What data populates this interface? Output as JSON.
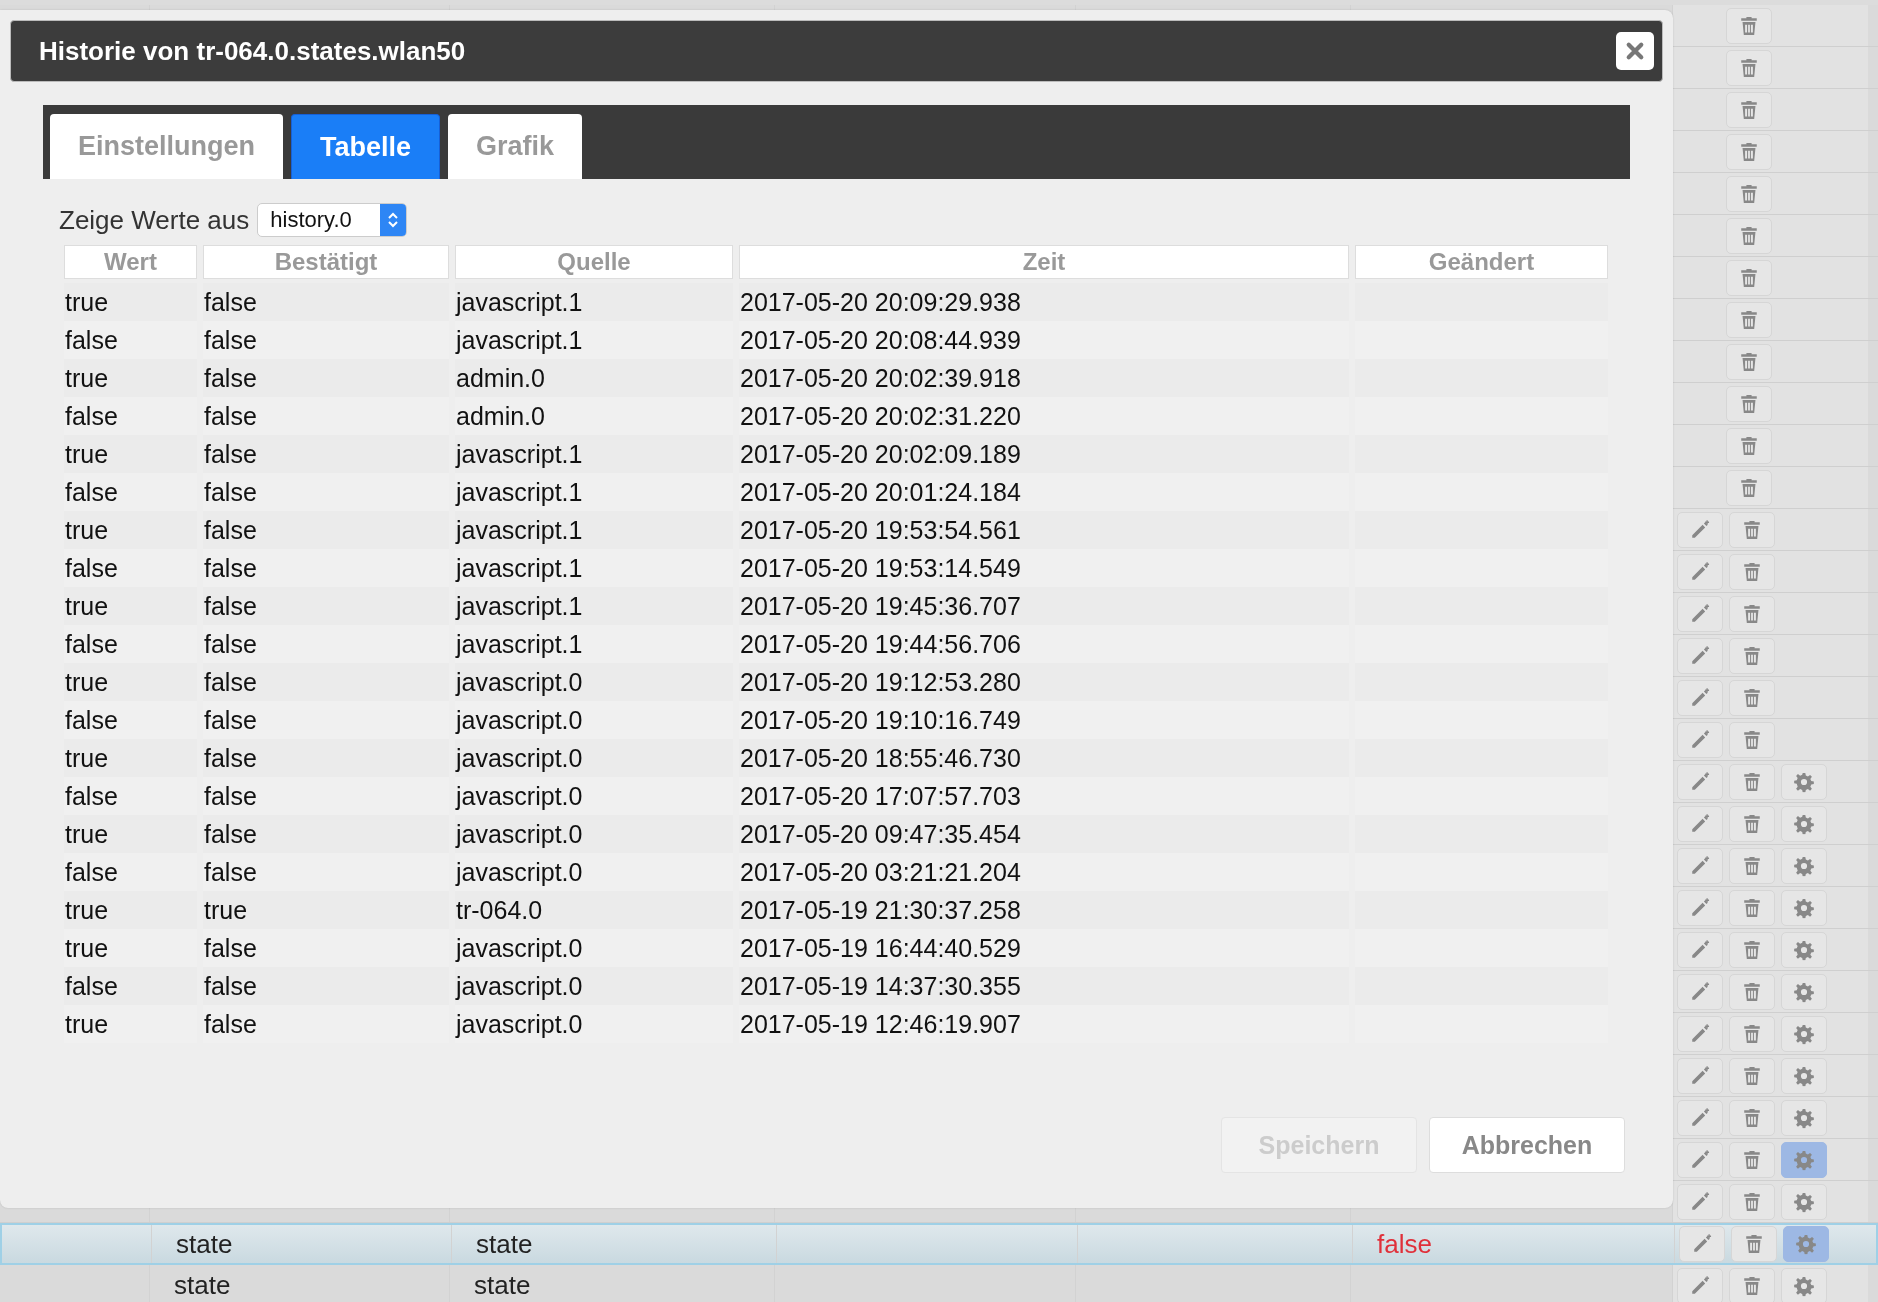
{
  "dialog": {
    "title": "Historie von tr-064.0.states.wlan50",
    "tabs": [
      {
        "label": "Einstellungen",
        "selected": false
      },
      {
        "label": "Tabelle",
        "selected": true
      },
      {
        "label": "Grafik",
        "selected": false
      }
    ],
    "source": {
      "label": "Zeige Werte aus",
      "value": "history.0"
    },
    "table": {
      "columns": [
        "Wert",
        "Bestätigt",
        "Quelle",
        "Zeit",
        "Geändert"
      ],
      "rows": [
        [
          "true",
          "false",
          "javascript.1",
          "2017-05-20 20:09:29.938"
        ],
        [
          "false",
          "false",
          "javascript.1",
          "2017-05-20 20:08:44.939"
        ],
        [
          "true",
          "false",
          "admin.0",
          "2017-05-20 20:02:39.918"
        ],
        [
          "false",
          "false",
          "admin.0",
          "2017-05-20 20:02:31.220"
        ],
        [
          "true",
          "false",
          "javascript.1",
          "2017-05-20 20:02:09.189"
        ],
        [
          "false",
          "false",
          "javascript.1",
          "2017-05-20 20:01:24.184"
        ],
        [
          "true",
          "false",
          "javascript.1",
          "2017-05-20 19:53:54.561"
        ],
        [
          "false",
          "false",
          "javascript.1",
          "2017-05-20 19:53:14.549"
        ],
        [
          "true",
          "false",
          "javascript.1",
          "2017-05-20 19:45:36.707"
        ],
        [
          "false",
          "false",
          "javascript.1",
          "2017-05-20 19:44:56.706"
        ],
        [
          "true",
          "false",
          "javascript.0",
          "2017-05-20 19:12:53.280"
        ],
        [
          "false",
          "false",
          "javascript.0",
          "2017-05-20 19:10:16.749"
        ],
        [
          "true",
          "false",
          "javascript.0",
          "2017-05-20 18:55:46.730"
        ],
        [
          "false",
          "false",
          "javascript.0",
          "2017-05-20 17:07:57.703"
        ],
        [
          "true",
          "false",
          "javascript.0",
          "2017-05-20 09:47:35.454"
        ],
        [
          "false",
          "false",
          "javascript.0",
          "2017-05-20 03:21:21.204"
        ],
        [
          "true",
          "true",
          "tr-064.0",
          "2017-05-19 21:30:37.258"
        ],
        [
          "true",
          "false",
          "javascript.0",
          "2017-05-19 16:44:40.529"
        ],
        [
          "false",
          "false",
          "javascript.0",
          "2017-05-19 14:37:30.355"
        ],
        [
          "true",
          "false",
          "javascript.0",
          "2017-05-19 12:46:19.907"
        ]
      ]
    },
    "buttons": [
      {
        "label": "Speichern",
        "disabled": true
      },
      {
        "label": "Abbrechen",
        "disabled": false
      }
    ]
  },
  "background_rows": [
    {
      "selected": false,
      "actions": [
        {
          "kind": "delete",
          "selected": false
        }
      ]
    },
    {
      "selected": false,
      "actions": [
        {
          "kind": "delete",
          "selected": false
        }
      ]
    },
    {
      "selected": false,
      "actions": [
        {
          "kind": "delete",
          "selected": false
        }
      ]
    },
    {
      "selected": false,
      "actions": [
        {
          "kind": "delete",
          "selected": false
        }
      ]
    },
    {
      "selected": false,
      "actions": [
        {
          "kind": "delete",
          "selected": false
        }
      ]
    },
    {
      "selected": false,
      "actions": [
        {
          "kind": "delete",
          "selected": false
        }
      ]
    },
    {
      "selected": false,
      "actions": [
        {
          "kind": "delete",
          "selected": false
        }
      ]
    },
    {
      "selected": false,
      "actions": [
        {
          "kind": "delete",
          "selected": false
        }
      ]
    },
    {
      "selected": false,
      "actions": [
        {
          "kind": "delete",
          "selected": false
        }
      ]
    },
    {
      "selected": false,
      "actions": [
        {
          "kind": "delete",
          "selected": false
        }
      ]
    },
    {
      "selected": false,
      "actions": [
        {
          "kind": "delete",
          "selected": false
        }
      ]
    },
    {
      "selected": false,
      "actions": [
        {
          "kind": "delete",
          "selected": false
        }
      ]
    },
    {
      "selected": false,
      "actions": [
        {
          "kind": "edit",
          "selected": false
        },
        {
          "kind": "delete",
          "selected": false
        }
      ]
    },
    {
      "selected": false,
      "actions": [
        {
          "kind": "edit",
          "selected": false
        },
        {
          "kind": "delete",
          "selected": false
        }
      ]
    },
    {
      "selected": false,
      "actions": [
        {
          "kind": "edit",
          "selected": false
        },
        {
          "kind": "delete",
          "selected": false
        }
      ]
    },
    {
      "selected": false,
      "actions": [
        {
          "kind": "edit",
          "selected": false
        },
        {
          "kind": "delete",
          "selected": false
        }
      ]
    },
    {
      "selected": false,
      "actions": [
        {
          "kind": "edit",
          "selected": false
        },
        {
          "kind": "delete",
          "selected": false
        }
      ]
    },
    {
      "selected": false,
      "actions": [
        {
          "kind": "edit",
          "selected": false
        },
        {
          "kind": "delete",
          "selected": false
        }
      ]
    },
    {
      "selected": false,
      "actions": [
        {
          "kind": "edit",
          "selected": false
        },
        {
          "kind": "delete",
          "selected": false
        },
        {
          "kind": "settings",
          "selected": false
        }
      ]
    },
    {
      "selected": false,
      "actions": [
        {
          "kind": "edit",
          "selected": false
        },
        {
          "kind": "delete",
          "selected": false
        },
        {
          "kind": "settings",
          "selected": false
        }
      ]
    },
    {
      "selected": false,
      "actions": [
        {
          "kind": "edit",
          "selected": false
        },
        {
          "kind": "delete",
          "selected": false
        },
        {
          "kind": "settings",
          "selected": false
        }
      ]
    },
    {
      "selected": false,
      "actions": [
        {
          "kind": "edit",
          "selected": false
        },
        {
          "kind": "delete",
          "selected": false
        },
        {
          "kind": "settings",
          "selected": false
        }
      ]
    },
    {
      "selected": false,
      "actions": [
        {
          "kind": "edit",
          "selected": false
        },
        {
          "kind": "delete",
          "selected": false
        },
        {
          "kind": "settings",
          "selected": false
        }
      ]
    },
    {
      "selected": false,
      "actions": [
        {
          "kind": "edit",
          "selected": false
        },
        {
          "kind": "delete",
          "selected": false
        },
        {
          "kind": "settings",
          "selected": false
        }
      ]
    },
    {
      "selected": false,
      "actions": [
        {
          "kind": "edit",
          "selected": false
        },
        {
          "kind": "delete",
          "selected": false
        },
        {
          "kind": "settings",
          "selected": false
        }
      ]
    },
    {
      "selected": false,
      "actions": [
        {
          "kind": "edit",
          "selected": false
        },
        {
          "kind": "delete",
          "selected": false
        },
        {
          "kind": "settings",
          "selected": false
        }
      ]
    },
    {
      "selected": false,
      "actions": [
        {
          "kind": "edit",
          "selected": false
        },
        {
          "kind": "delete",
          "selected": false
        },
        {
          "kind": "settings",
          "selected": false
        }
      ]
    },
    {
      "selected": false,
      "actions": [
        {
          "kind": "edit",
          "selected": false
        },
        {
          "kind": "delete",
          "selected": false
        },
        {
          "kind": "settings",
          "selected": true
        }
      ]
    },
    {
      "selected": false,
      "actions": [
        {
          "kind": "edit",
          "selected": false
        },
        {
          "kind": "delete",
          "selected": false
        },
        {
          "kind": "settings",
          "selected": false
        }
      ]
    },
    {
      "selected": true,
      "name": "state",
      "type": "state",
      "value": "false",
      "actions": [
        {
          "kind": "edit",
          "selected": false
        },
        {
          "kind": "delete",
          "selected": false
        },
        {
          "kind": "settings",
          "selected": true
        }
      ]
    },
    {
      "selected": false,
      "name": "state",
      "type": "state",
      "actions": [
        {
          "kind": "edit",
          "selected": false
        },
        {
          "kind": "delete",
          "selected": false
        },
        {
          "kind": "settings",
          "selected": false
        }
      ]
    }
  ]
}
